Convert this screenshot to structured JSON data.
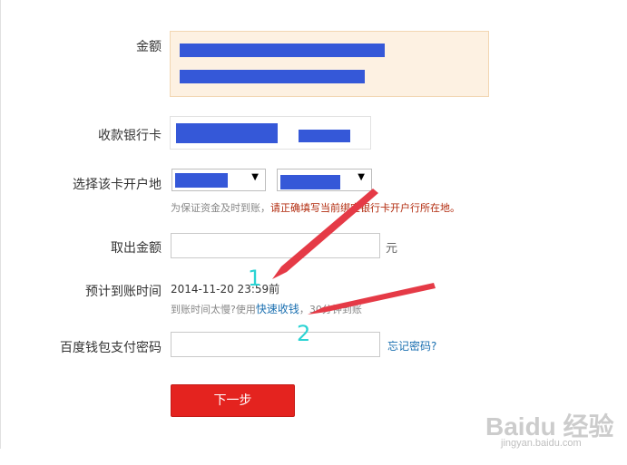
{
  "form": {
    "amount_label": "金额",
    "card_label": "收款银行卡",
    "region_label": "选择该卡开户地",
    "region_hint_prefix": "为保证资金及时到账，",
    "region_hint_warning": "请正确填写当前绑定银行卡开户行所在地。",
    "withdraw_label": "取出金额",
    "withdraw_unit": "元",
    "eta_label": "预计到账时间",
    "eta_value": "2014-11-20 23:59前",
    "eta_hint_prefix": "到账时间太慢?使用",
    "eta_fast_link": "快速收钱",
    "eta_hint_suffix": "，30分钟到账",
    "password_label": "百度钱包支付密码",
    "forgot_password": "忘记密码?",
    "next_button": "下一步"
  },
  "annotations": {
    "arrow1_number": "1",
    "arrow2_number": "2"
  },
  "watermark": {
    "logo": "Baidu 经验",
    "url": "jingyan.baidu.com"
  },
  "colors": {
    "redaction": "#3558d8",
    "accent_button": "#e4231f",
    "warning_text": "#b22b0e",
    "link": "#1a6fb0",
    "annotation": "#2bd3d3"
  }
}
